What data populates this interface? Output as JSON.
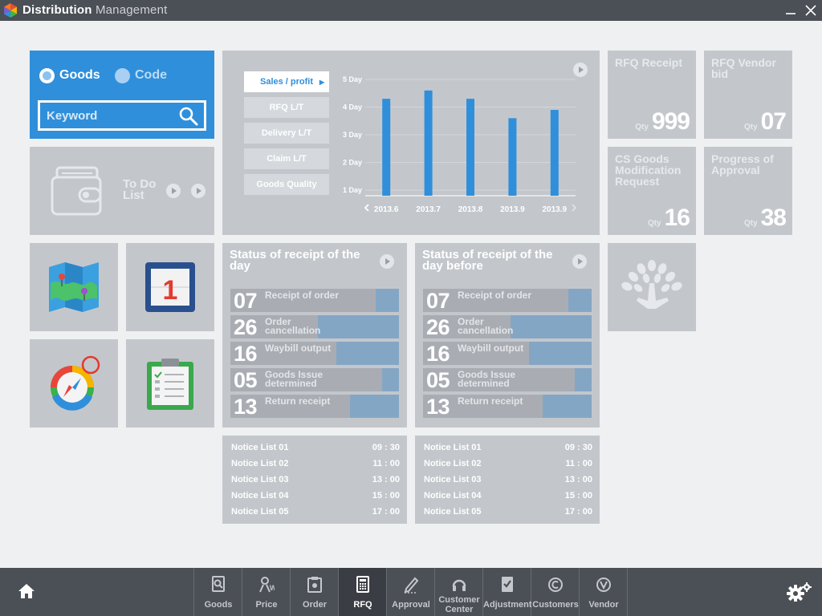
{
  "app": {
    "title_part1": "Distribution",
    "title_part2": "Management"
  },
  "search": {
    "radio_goods": "Goods",
    "radio_code": "Code",
    "placeholder": "Keyword"
  },
  "todo": {
    "label": "To Do List"
  },
  "chart_tabs": [
    "Sales / profit",
    "RFQ L/T",
    "Delivery L/T",
    "Claim L/T",
    "Goods Quality"
  ],
  "chart_data": {
    "type": "bar",
    "categories": [
      "2013.6",
      "2013.7",
      "2013.8",
      "2013.9",
      "2013.9"
    ],
    "values": [
      4.3,
      4.6,
      4.3,
      3.6,
      3.9
    ],
    "y_ticks": [
      "1 Day",
      "2 Day",
      "3 Day",
      "4 Day",
      "5 Day"
    ],
    "ylim": [
      0.8,
      5
    ],
    "grid": true,
    "title": "",
    "xlabel": "",
    "ylabel": "",
    "bar_color": "#2f8fdb"
  },
  "stats": [
    {
      "title": "RFQ Receipt",
      "qty_label": "Qty",
      "value": "999"
    },
    {
      "title": "RFQ Vendor bid",
      "qty_label": "Qty",
      "value": "07"
    },
    {
      "title": "CS Goods Modification Request",
      "qty_label": "Qty",
      "value": "16"
    },
    {
      "title": "Progress of Approval",
      "qty_label": "Qty",
      "value": "38"
    }
  ],
  "status_today": {
    "title": "Status of receipt of the day",
    "rows": [
      {
        "num": "07",
        "label": "Receipt of order",
        "fill": 0.14
      },
      {
        "num": "26",
        "label": "Order cancellation",
        "fill": 0.48
      },
      {
        "num": "16",
        "label": "Waybill output",
        "fill": 0.37
      },
      {
        "num": "05",
        "label": "Goods Issue determined",
        "fill": 0.1
      },
      {
        "num": "13",
        "label": "Return receipt",
        "fill": 0.29
      }
    ]
  },
  "status_before": {
    "title": "Status of receipt of the day before",
    "rows": [
      {
        "num": "07",
        "label": "Receipt of order",
        "fill": 0.14
      },
      {
        "num": "26",
        "label": "Order cancellation",
        "fill": 0.48
      },
      {
        "num": "16",
        "label": "Waybill output",
        "fill": 0.37
      },
      {
        "num": "05",
        "label": "Goods Issue determined",
        "fill": 0.1
      },
      {
        "num": "13",
        "label": "Return receipt",
        "fill": 0.29
      }
    ]
  },
  "notices_today": [
    {
      "name": "Notice List 01",
      "time": "09 : 30"
    },
    {
      "name": "Notice List 02",
      "time": "11 : 00"
    },
    {
      "name": "Notice List 03",
      "time": "13 : 00"
    },
    {
      "name": "Notice List 04",
      "time": "15 : 00"
    },
    {
      "name": "Notice List 05",
      "time": "17 : 00"
    }
  ],
  "notices_before": [
    {
      "name": "Notice List 01",
      "time": "09 : 30"
    },
    {
      "name": "Notice List 02",
      "time": "11 : 00"
    },
    {
      "name": "Notice List 03",
      "time": "13 : 00"
    },
    {
      "name": "Notice List 04",
      "time": "15 : 00"
    },
    {
      "name": "Notice List 05",
      "time": "17 : 00"
    }
  ],
  "nav": [
    {
      "label": "Goods",
      "icon": "search-doc-icon"
    },
    {
      "label": "Price",
      "icon": "price-icon"
    },
    {
      "label": "Order",
      "icon": "order-icon"
    },
    {
      "label": "RFQ",
      "icon": "calculator-icon"
    },
    {
      "label": "Approval",
      "icon": "pen-icon"
    },
    {
      "label": "Customer Center",
      "icon": "headset-icon"
    },
    {
      "label": "Adjustment",
      "icon": "check-doc-icon"
    },
    {
      "label": "Customers",
      "icon": "copyright-icon"
    },
    {
      "label": "Vendor",
      "icon": "v-circle-icon"
    }
  ],
  "colors": {
    "accent": "#2f8fdb",
    "tile": "#c3c7cc",
    "bar_dark": "#4b4f56",
    "status_fill": "#84a6c5"
  }
}
